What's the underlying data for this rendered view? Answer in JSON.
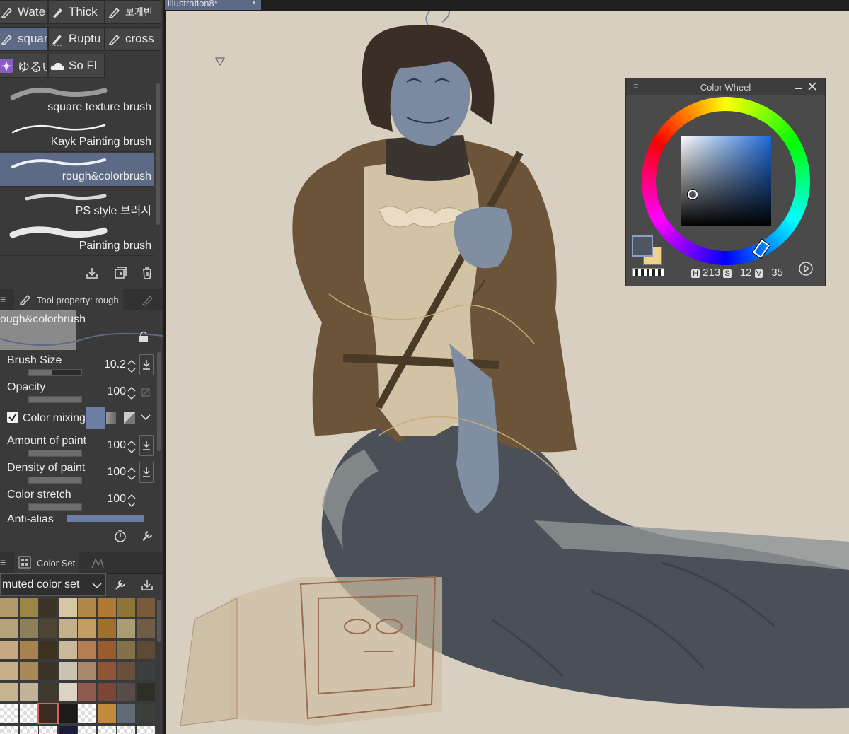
{
  "sub_tools": [
    {
      "label": "Wate",
      "icon": "brush-icon",
      "active": false
    },
    {
      "label": "Thick",
      "icon": "brush-icon",
      "active": false
    },
    {
      "label": "보게빈",
      "icon": "brush-icon",
      "active": false
    },
    {
      "label": "squar",
      "icon": "brush-icon",
      "active": true
    },
    {
      "label": "Ruptu",
      "icon": "brush-icon",
      "active": false
    },
    {
      "label": "cross",
      "icon": "brush-icon",
      "active": false
    },
    {
      "label": "ゆるい",
      "icon": "sparkle-icon",
      "active": false
    },
    {
      "label": "So Fl",
      "icon": "cloud-icon",
      "active": false
    }
  ],
  "brushes": [
    {
      "label": "square texture brush",
      "active": false
    },
    {
      "label": "Kayk Painting brush",
      "active": false
    },
    {
      "label": "rough&colorbrush",
      "active": true
    },
    {
      "label": "PS style 브러시",
      "active": false
    },
    {
      "label": "Painting brush",
      "active": false
    }
  ],
  "tool_property": {
    "tab_label": "Tool property: rough",
    "brush_name": "ough&colorbrush",
    "rows": [
      {
        "label": "Brush Size",
        "value": "10.2",
        "fill": 0.45
      },
      {
        "label": "Opacity",
        "value": "100",
        "fill": 1.0
      },
      {
        "label": "Color mixing",
        "checked": true
      },
      {
        "label": "Amount of paint",
        "value": "100",
        "fill": 1.0
      },
      {
        "label": "Density of paint",
        "value": "100",
        "fill": 1.0
      },
      {
        "label": "Color stretch",
        "value": "100",
        "fill": 1.0
      }
    ],
    "cut_label": "Anti-alias"
  },
  "color_set": {
    "tab_label": "Color Set",
    "set_name": "muted color set",
    "rows": [
      [
        "#b39a6a",
        "#9d8545",
        "#3f342a",
        "#d6c6a2",
        "#b2874a",
        "#b07a35",
        "#8f7437",
        "#7a5a3a"
      ],
      [
        "#b5a278",
        "#8d8059",
        "#4d4434",
        "#c2b08b",
        "#c39d63",
        "#a1702f",
        "#a89d73",
        "#6f5e45"
      ],
      [
        "#c7a984",
        "#a9814f",
        "#3b3220",
        "#c9b99a",
        "#b17e55",
        "#9a5b2f",
        "#857149",
        "#5d4a35"
      ],
      [
        "#c8b088",
        "#a98a54",
        "#3a3226",
        "#cbc2b3",
        "#a88868",
        "#8f5535",
        "#68503d",
        "#3c3f40"
      ],
      [
        "#c6b390",
        "#c0b398",
        "#3f3a2e",
        "#ddd3c3",
        "#8f5a4f",
        "#7a4636",
        "#5a4c48",
        "#2e3028"
      ],
      [
        "transparent",
        "transparent",
        "#3b2a22",
        "#1e1a18",
        "transparent",
        "#c28a3f",
        "#5e6a74",
        "#3a4038"
      ],
      [
        "transparent",
        "transparent",
        "transparent",
        "#1e1a3a",
        "transparent",
        "transparent",
        "transparent",
        "transparent"
      ]
    ]
  },
  "document": {
    "tab_label": "illustration8*"
  },
  "color_wheel": {
    "title": "Color Wheel",
    "h_label": "H",
    "h_value": "213",
    "s_label": "S",
    "s_value": "12",
    "v_label": "V",
    "v_value": "35",
    "main_color": "#4f5662",
    "sub_color": "#f0d28a"
  }
}
